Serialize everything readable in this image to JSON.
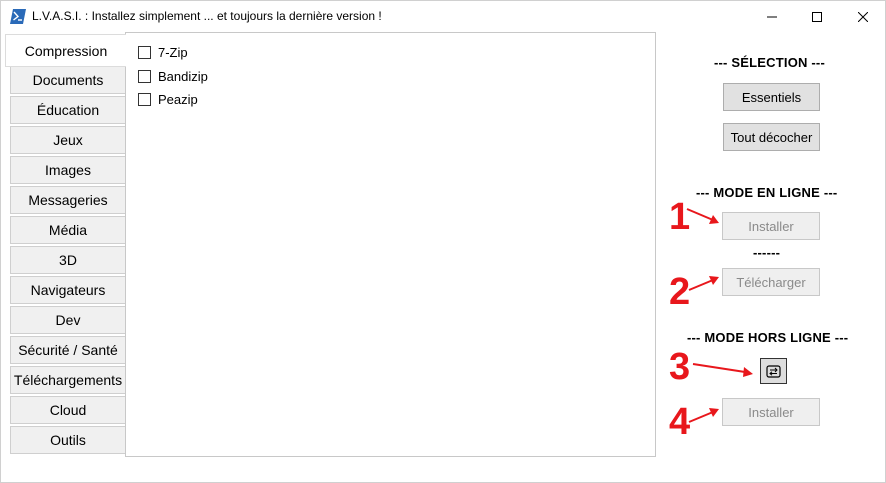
{
  "window": {
    "title": "L.V.A.S.I. : Installez simplement ... et toujours la dernière version !"
  },
  "tabs": [
    {
      "label": "Compression",
      "active": true
    },
    {
      "label": "Documents"
    },
    {
      "label": "Éducation"
    },
    {
      "label": "Jeux"
    },
    {
      "label": "Images"
    },
    {
      "label": "Messageries"
    },
    {
      "label": "Média"
    },
    {
      "label": "3D"
    },
    {
      "label": "Navigateurs"
    },
    {
      "label": "Dev"
    },
    {
      "label": "Sécurité / Santé"
    },
    {
      "label": "Téléchargements"
    },
    {
      "label": "Cloud"
    },
    {
      "label": "Outils"
    }
  ],
  "apps": [
    {
      "label": "7-Zip",
      "checked": false
    },
    {
      "label": "Bandizip",
      "checked": false
    },
    {
      "label": "Peazip",
      "checked": false
    }
  ],
  "selection": {
    "title": "--- SÉLECTION ---",
    "essentials_label": "Essentiels",
    "uncheck_all_label": "Tout décocher"
  },
  "online": {
    "title": "--- MODE EN LIGNE ---",
    "install_label": "Installer",
    "separator": "------",
    "download_label": "Télécharger"
  },
  "offline": {
    "title": "--- MODE HORS LIGNE ---",
    "install_label": "Installer"
  },
  "annotations": {
    "step1": "1",
    "step2": "2",
    "step3": "3",
    "step4": "4",
    "color": "#e8171c"
  }
}
